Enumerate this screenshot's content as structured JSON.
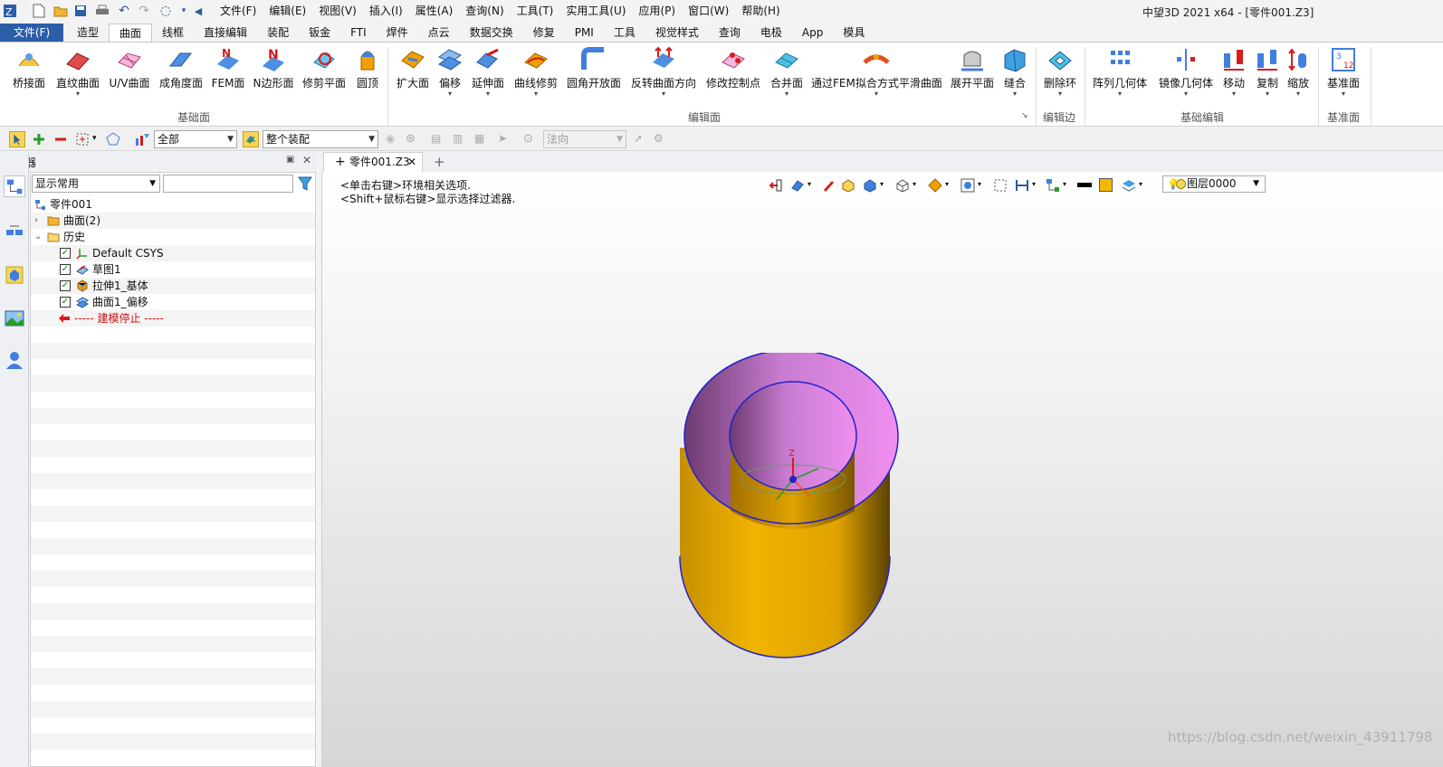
{
  "app": {
    "window_title": "中望3D 2021 x64 - [零件001.Z3]"
  },
  "menu": [
    "文件(F)",
    "编辑(E)",
    "视图(V)",
    "插入(I)",
    "属性(A)",
    "查询(N)",
    "工具(T)",
    "实用工具(U)",
    "应用(P)",
    "窗口(W)",
    "帮助(H)"
  ],
  "ribbon_tabs": [
    "文件(F)",
    "造型",
    "曲面",
    "线框",
    "直接编辑",
    "装配",
    "钣金",
    "FTI",
    "焊件",
    "点云",
    "数据交换",
    "修复",
    "PMI",
    "工具",
    "视觉样式",
    "查询",
    "电极",
    "App",
    "模具"
  ],
  "active_tab": "曲面",
  "ribbon": {
    "base_surface": {
      "group_label": "基础面",
      "buttons": [
        "桥接面",
        "直纹曲面",
        "U/V曲面",
        "成角度面",
        "FEM面",
        "N边形面",
        "修剪平面",
        "圆顶"
      ]
    },
    "edit_surface": {
      "group_label": "编辑面",
      "buttons": [
        "扩大面",
        "偏移",
        "延伸面",
        "曲线修剪",
        "圆角开放面",
        "反转曲面方向",
        "修改控制点",
        "合并面",
        "通过FEM拟合方式平滑曲面",
        "展开平面",
        "缝合"
      ]
    },
    "edit_edge": {
      "group_label": "编辑边",
      "buttons": [
        "删除环"
      ]
    },
    "base_edit": {
      "group_label": "基础编辑",
      "buttons": [
        "阵列几何体",
        "镜像几何体",
        "移动",
        "复制",
        "缩放"
      ]
    },
    "datum": {
      "group_label": "基准面",
      "buttons": [
        "基准面"
      ]
    }
  },
  "selection_toolbar": {
    "filter_value": "全部",
    "scope_value": "整个装配",
    "direction_placeholder": "法向"
  },
  "manager": {
    "title": "管理器",
    "filter_value": "显示常用",
    "search_value": "",
    "tree": {
      "root": "零件001",
      "surfaces": "曲面(2)",
      "history": "历史",
      "items": [
        "Default CSYS",
        "草图1",
        "拉伸1_基体",
        "曲面1_偏移"
      ],
      "stop": "----- 建模停止 -----"
    }
  },
  "document_tab": "零件001.Z3",
  "viewport": {
    "hint_line1": "<单击右键>环境相关选项.",
    "hint_line2": "<Shift+鼠标右键>显示选择过滤器.",
    "layer": "图层0000",
    "watermark": "https://blog.csdn.net/weixin_43911798"
  },
  "colors": {
    "file_tab": "#2c5ea8",
    "cylinder_outer": "#e0a300",
    "cylinder_inner": "#e78ee5",
    "edge": "#2222cc"
  }
}
